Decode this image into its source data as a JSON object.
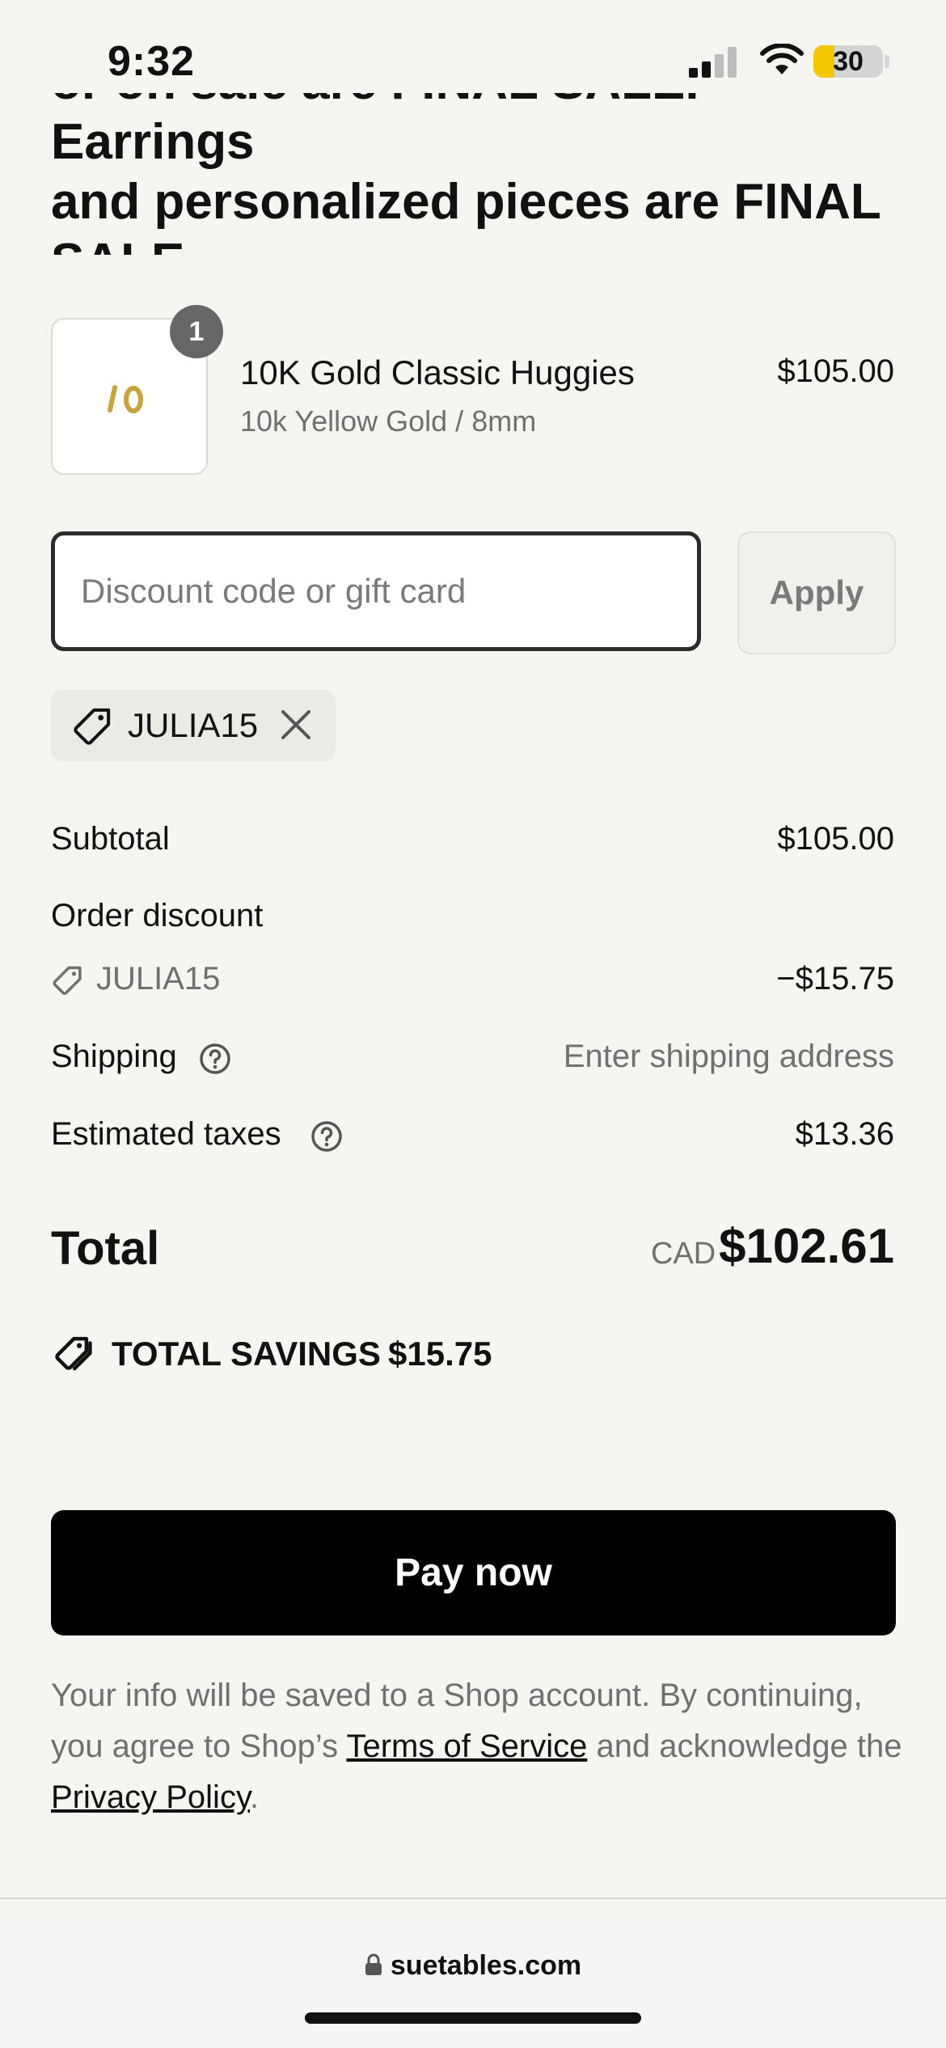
{
  "status_bar": {
    "time": "9:32",
    "battery": "30",
    "battery_level": 0.3
  },
  "heading": {
    "partial_top": "or on sale are FINAL SALE. Earrings",
    "text": "and personalized pieces are FINAL SALE"
  },
  "line_item": {
    "quantity": "1",
    "name": "10K Gold Classic Huggies",
    "variant": "10k Yellow Gold / 8mm",
    "price": "$105.00",
    "thumbnail_icon": "gold-huggie-earrings-image"
  },
  "discount": {
    "placeholder": "Discount code or gift card",
    "value": "",
    "apply_label": "Apply",
    "applied_code": "JULIA15"
  },
  "summary": {
    "subtotal_label": "Subtotal",
    "subtotal_value": "$105.00",
    "order_discount_label": "Order discount",
    "discount_code": "JULIA15",
    "discount_value": "−$15.75",
    "shipping_label": "Shipping",
    "shipping_value": "Enter shipping address",
    "taxes_label": "Estimated taxes",
    "taxes_value": "$13.36",
    "total_label": "Total",
    "currency": "CAD",
    "total_value": "$102.61",
    "savings_label": "TOTAL SAVINGS",
    "savings_value": "$15.75"
  },
  "actions": {
    "pay_label": "Pay now"
  },
  "legal": {
    "text_1": "Your info will be saved to a Shop account. By continuing, you agree to Shop’s ",
    "terms_link": "Terms of Service",
    "text_2": " and acknowledge the ",
    "privacy_link": "Privacy Policy",
    "text_3": "."
  },
  "browser": {
    "domain": "suetables.com"
  },
  "colors": {
    "background": "#f6f5f2",
    "primary_button": "#000000",
    "muted_text": "#707070",
    "battery_accent": "#f5c700"
  }
}
